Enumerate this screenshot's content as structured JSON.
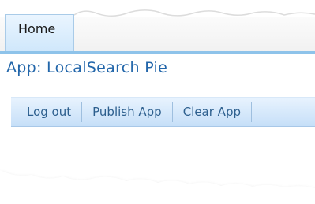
{
  "tabs": [
    {
      "label": "Home"
    }
  ],
  "app": {
    "title": "App: LocalSearch Pie"
  },
  "toolbar": {
    "logout_label": "Log out",
    "publish_label": "Publish App",
    "clear_label": "Clear App"
  },
  "colors": {
    "title_text": "#2266aa",
    "toolbar_text": "#2d5f8e",
    "tab_active_bg": "#cfe7fb",
    "toolbar_bg": "#c6dff8"
  }
}
